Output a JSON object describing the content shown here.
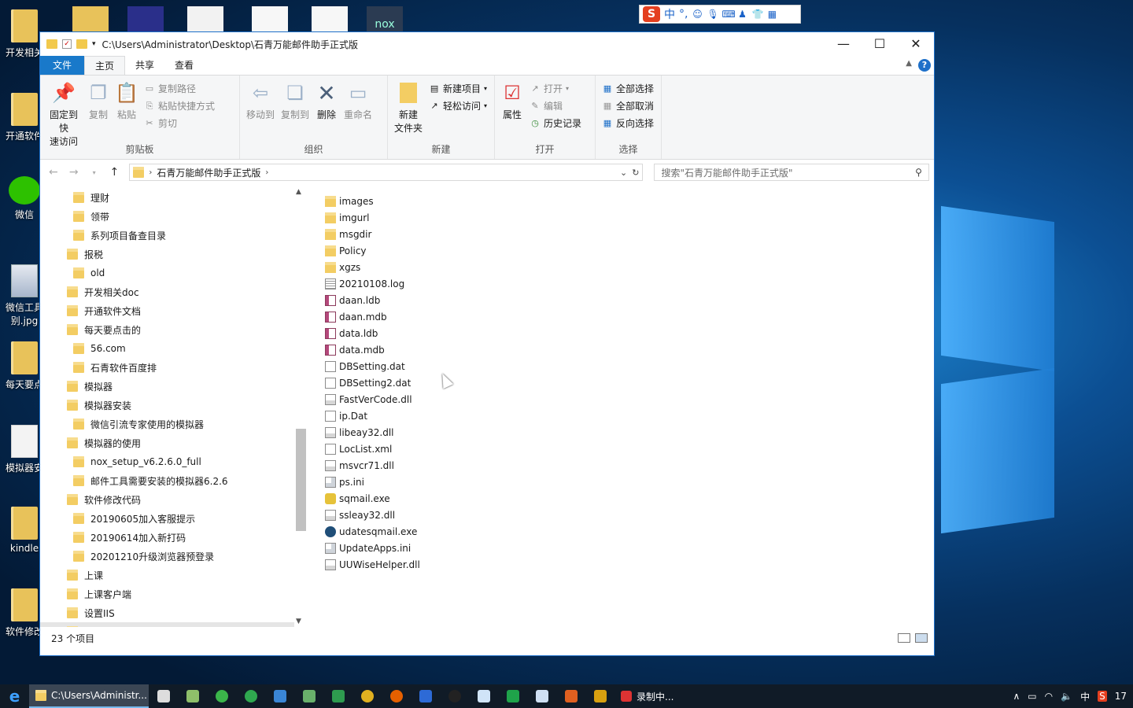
{
  "desktop": {
    "icons": [
      {
        "label": "开发相关"
      },
      {
        "label": "开通软件"
      },
      {
        "label": "微信"
      },
      {
        "label": "微信工具别.jpg"
      },
      {
        "label": "每天要点"
      },
      {
        "label": "模拟器安"
      },
      {
        "label": "kindle"
      },
      {
        "label": "软件修改"
      }
    ],
    "top_icon_labels": [
      "nox"
    ]
  },
  "ime": {
    "logo": "S",
    "mode": "中",
    "punct": "°,"
  },
  "window": {
    "title": "C:\\Users\\Administrator\\Desktop\\石青万能邮件助手正式版",
    "controls": {
      "minimize": "—",
      "maximize": "☐",
      "close": "✕"
    },
    "tabs": {
      "file": "文件",
      "home": "主页",
      "share": "共享",
      "view": "查看",
      "help": "?"
    },
    "ribbon": {
      "clipboard": {
        "title": "剪贴板",
        "pin": "固定到快\n速访问",
        "copy": "复制",
        "paste": "粘贴",
        "copy_path": "复制路径",
        "paste_shortcut": "粘贴快捷方式",
        "cut": "剪切"
      },
      "organize": {
        "title": "组织",
        "move_to": "移动到",
        "copy_to": "复制到",
        "delete": "删除",
        "rename": "重命名"
      },
      "new": {
        "title": "新建",
        "new_folder": "新建\n文件夹",
        "new_item": "新建项目",
        "easy_access": "轻松访问"
      },
      "open": {
        "title": "打开",
        "properties": "属性",
        "open": "打开",
        "edit": "编辑",
        "history": "历史记录"
      },
      "select": {
        "title": "选择",
        "select_all": "全部选择",
        "select_none": "全部取消",
        "invert": "反向选择"
      }
    },
    "address": {
      "crumb": "石青万能邮件助手正式版"
    },
    "search": {
      "placeholder": "搜索\"石青万能邮件助手正式版\""
    },
    "tree": [
      {
        "label": "理财",
        "indent": 2
      },
      {
        "label": "领带",
        "indent": 2
      },
      {
        "label": "系列项目备查目录",
        "indent": 2
      },
      {
        "label": "报税",
        "indent": 1
      },
      {
        "label": "old",
        "indent": 2
      },
      {
        "label": "开发相关doc",
        "indent": 1
      },
      {
        "label": "开通软件文档",
        "indent": 1
      },
      {
        "label": "每天要点击的",
        "indent": 1
      },
      {
        "label": "56.com",
        "indent": 2
      },
      {
        "label": "石青软件百度排",
        "indent": 2
      },
      {
        "label": "模拟器",
        "indent": 1
      },
      {
        "label": "模拟器安装",
        "indent": 1
      },
      {
        "label": "微信引流专家使用的模拟器",
        "indent": 2
      },
      {
        "label": "模拟器的使用",
        "indent": 1
      },
      {
        "label": "nox_setup_v6.2.6.0_full",
        "indent": 2
      },
      {
        "label": "邮件工具需要安装的模拟器6.2.6",
        "indent": 2
      },
      {
        "label": "软件修改代码",
        "indent": 1
      },
      {
        "label": "20190605加入客服提示",
        "indent": 2
      },
      {
        "label": "20190614加入新打码",
        "indent": 2
      },
      {
        "label": "20201210升级浏览器预登录",
        "indent": 2
      },
      {
        "label": "上课",
        "indent": 1
      },
      {
        "label": "上课客户端",
        "indent": 1
      },
      {
        "label": "设置IIS",
        "indent": 1
      },
      {
        "label": "石青万能邮件助手正式版",
        "indent": 1,
        "selected": true
      }
    ],
    "files": [
      {
        "name": "images",
        "icon": "folder"
      },
      {
        "name": "imgurl",
        "icon": "folder"
      },
      {
        "name": "msgdir",
        "icon": "folder"
      },
      {
        "name": "Policy",
        "icon": "folder"
      },
      {
        "name": "xgzs",
        "icon": "folder"
      },
      {
        "name": "20210108.log",
        "icon": "log"
      },
      {
        "name": "daan.ldb",
        "icon": "db"
      },
      {
        "name": "daan.mdb",
        "icon": "db"
      },
      {
        "name": "data.ldb",
        "icon": "db"
      },
      {
        "name": "data.mdb",
        "icon": "db"
      },
      {
        "name": "DBSetting.dat",
        "icon": "doc"
      },
      {
        "name": "DBSetting2.dat",
        "icon": "doc"
      },
      {
        "name": "FastVerCode.dll",
        "icon": "dll"
      },
      {
        "name": "ip.Dat",
        "icon": "doc"
      },
      {
        "name": "libeay32.dll",
        "icon": "dll"
      },
      {
        "name": "LocList.xml",
        "icon": "doc"
      },
      {
        "name": "msvcr71.dll",
        "icon": "dll"
      },
      {
        "name": "ps.ini",
        "icon": "ini"
      },
      {
        "name": "sqmail.exe",
        "icon": "exe1"
      },
      {
        "name": "ssleay32.dll",
        "icon": "dll"
      },
      {
        "name": "udatesqmail.exe",
        "icon": "exe2"
      },
      {
        "name": "UpdateApps.ini",
        "icon": "ini"
      },
      {
        "name": "UUWiseHelper.dll",
        "icon": "dll"
      }
    ],
    "status": {
      "count": "23 个项目"
    }
  },
  "taskbar": {
    "active_window": "C:\\Users\\Administr...",
    "recording": "录制中...",
    "tray": {
      "ime": "中",
      "extra": "17"
    }
  },
  "colors": {
    "accent": "#1979ca",
    "ribbon_bg": "#f5f6f7",
    "taskbar": "#101b27"
  }
}
